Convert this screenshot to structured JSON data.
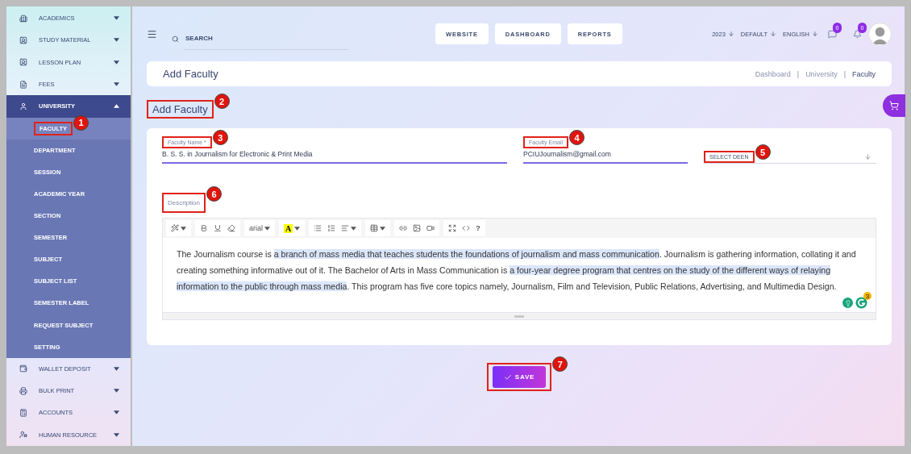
{
  "sidebar": {
    "items": [
      {
        "label": "ACADEMICS",
        "expanded": false
      },
      {
        "label": "STUDY MATERIAL",
        "expanded": false
      },
      {
        "label": "LESSON PLAN",
        "expanded": false
      },
      {
        "label": "FEES",
        "expanded": false
      },
      {
        "label": "UNIVERSITY",
        "expanded": true,
        "children": [
          {
            "label": "FACULTY",
            "selected": true,
            "marker": "1"
          },
          {
            "label": "DEPARTMENT",
            "selected": false
          },
          {
            "label": "SESSION",
            "selected": false
          },
          {
            "label": "ACADEMIC YEAR",
            "selected": false
          },
          {
            "label": "SECTION",
            "selected": false
          },
          {
            "label": "SEMESTER",
            "selected": false
          },
          {
            "label": "SUBJECT",
            "selected": false
          },
          {
            "label": "SUBJECT LIST",
            "selected": false
          },
          {
            "label": "SEMESTER LABEL",
            "selected": false
          },
          {
            "label": "REQUEST SUBJECT",
            "selected": false
          },
          {
            "label": "SETTING",
            "selected": false
          }
        ]
      },
      {
        "label": "WALLET DEPOSIT",
        "expanded": false
      },
      {
        "label": "BULK PRINT",
        "expanded": false
      },
      {
        "label": "ACCOUNTS",
        "expanded": false
      },
      {
        "label": "HUMAN RESOURCE",
        "expanded": false
      }
    ]
  },
  "header": {
    "search": {
      "placeholder": "SEARCH"
    },
    "buttons": [
      "WEBSITE",
      "DASHBOARD",
      "REPORTS"
    ],
    "selectors": [
      "2023",
      "DEFAULT",
      "ENGLISH"
    ],
    "message_badge": "0",
    "notification_badge": "0"
  },
  "page_header": {
    "title": "Add Faculty",
    "separators": [
      "|",
      "|"
    ],
    "breadcrumbs": [
      {
        "label": "Dashboard",
        "selected": false
      },
      {
        "label": "University",
        "selected": false
      },
      {
        "label": "Faculty",
        "selected": true
      }
    ]
  },
  "form": {
    "heading": {
      "text": "Add Faculty",
      "marker": "2"
    },
    "fields": [
      {
        "kind": "text",
        "label": "Faculty Name *",
        "value": "B. S. S. in Journalism for Electronic & Print Media",
        "marker": "3"
      },
      {
        "kind": "text",
        "label": "Faculty Email",
        "value": "PCIUJournalism@gmail.com",
        "marker": "4"
      },
      {
        "kind": "select",
        "placeholder": "SELECT DEEN",
        "marker": "5"
      }
    ],
    "description": {
      "label": "Description",
      "marker": "6",
      "toolbar": [
        {
          "tools": [
            {
              "kind": "magic",
              "dropdown": true
            }
          ]
        },
        {
          "tools": [
            {
              "kind": "bold",
              "dropdown": false
            },
            {
              "kind": "underline",
              "dropdown": false
            },
            {
              "kind": "eraser",
              "dropdown": false
            }
          ]
        },
        {
          "tools": [
            {
              "kind": "font",
              "label": "arial",
              "dropdown": true
            }
          ]
        },
        {
          "tools": [
            {
              "kind": "color",
              "label": "A",
              "dropdown": true
            }
          ]
        },
        {
          "tools": [
            {
              "kind": "ul",
              "dropdown": false
            },
            {
              "kind": "ol",
              "dropdown": false
            },
            {
              "kind": "align",
              "dropdown": true
            }
          ]
        },
        {
          "tools": [
            {
              "kind": "table",
              "dropdown": true
            }
          ]
        },
        {
          "tools": [
            {
              "kind": "link",
              "dropdown": false
            },
            {
              "kind": "image",
              "dropdown": false
            },
            {
              "kind": "video",
              "dropdown": false
            }
          ]
        },
        {
          "tools": [
            {
              "kind": "fullscreen",
              "dropdown": false
            },
            {
              "kind": "code",
              "dropdown": false
            },
            {
              "kind": "help",
              "label": "?",
              "dropdown": false
            }
          ]
        }
      ],
      "content": [
        {
          "text": "The Journalism course is ",
          "highlighted": false
        },
        {
          "text": "a branch of mass media that teaches students the foundations of journalism and mass communication",
          "highlighted": true
        },
        {
          "text": ". Journalism is gathering information, collating it and creating something informative out of it. The Bachelor of Arts in Mass Communication is ",
          "highlighted": false
        },
        {
          "text": "a four-year degree program that centres on the study of the different ways of relaying information to the public through mass media",
          "highlighted": true
        },
        {
          "text": ". This program has five core topics namely, Journalism, Film and Television, Public Relations, Advertising, and Multimedia Design.",
          "highlighted": false
        }
      ],
      "assistant_badge": "3"
    },
    "save_button": {
      "label": "SAVE",
      "marker": "7"
    }
  }
}
